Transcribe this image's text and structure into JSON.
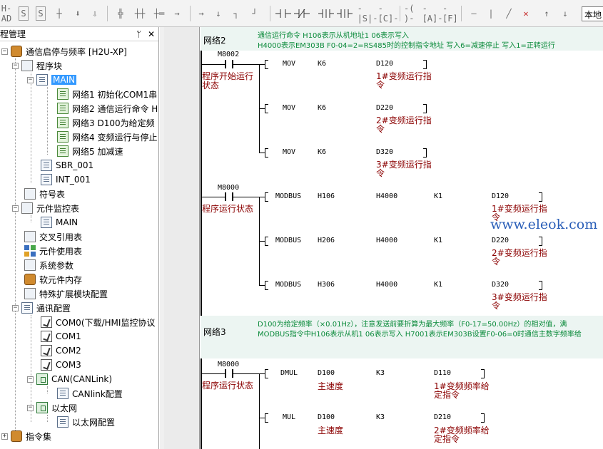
{
  "toolbar": {
    "right_box_text": "本地",
    "buttons": [
      "H-AD",
      "S",
      "S",
      "┼",
      "⬇",
      "⇩",
      "╬",
      "┼┼",
      "┼═",
      "→",
      "↓",
      "┐",
      "┘",
      "-|  |-",
      "-|/|-",
      "-|↑|-",
      "-|↓|-",
      "-|S|-",
      "-[C]-",
      "-( )-",
      "-[A]-",
      "-[F]",
      "—",
      "|",
      "╱",
      "✕",
      "↑",
      "↓"
    ]
  },
  "left_panel": {
    "title": "程管理",
    "pin": "ᛘ",
    "close": "✕",
    "tree": {
      "root": "通信启停与频率 [H2U-XP]",
      "program_block": "程序块",
      "main": "MAIN",
      "networks": [
        "网络1 初始化COM1串",
        "网络2 通信运行命令 H",
        "网络3 D100为给定频",
        "网络4 变频运行与停止",
        "网络5 加减速"
      ],
      "sbr": "SBR_001",
      "int": "INT_001",
      "symbol_table": "符号表",
      "monitor_table": "元件监控表",
      "monitor_main": "MAIN",
      "cross_ref": "交叉引用表",
      "usage_table": "元件使用表",
      "sys_params": "系统参数",
      "soft_memory": "软元件内存",
      "special_module": "特殊扩展模块配置",
      "comm_config": "通讯配置",
      "com0": "COM0(下载/HMI监控协议",
      "com1": "COM1",
      "com2": "COM2",
      "com3": "COM3",
      "can": "CAN(CANLink)",
      "canlink": "CANlink配置",
      "ethernet": "以太网",
      "ethernet_config": "以太网配置",
      "instruction_set": "指令集"
    }
  },
  "editor": {
    "network2": {
      "title": "网络2",
      "comment_line1": "通信运行命令 H106表示从机地址1 06表示写入",
      "comment_line2": "H4000表示EM303B F0-04=2=RS485时的控制指令地址 写入6=减速停止 写入1=正转运行",
      "contact1": "M8002",
      "contact1_comment": [
        "程序开始运行",
        "状态"
      ],
      "movs": [
        {
          "op": "MOV",
          "a": "K6",
          "b": "D120",
          "c": [
            "1#变频运行指",
            "令"
          ]
        },
        {
          "op": "MOV",
          "a": "K6",
          "b": "D220",
          "c": [
            "2#变频运行指",
            "令"
          ]
        },
        {
          "op": "MOV",
          "a": "K6",
          "b": "D320",
          "c": [
            "3#变频运行指",
            "令"
          ]
        }
      ],
      "contact2": "M8000",
      "contact2_comment": "程序运行状态",
      "modbus": [
        {
          "op": "MODBUS",
          "a": "H106",
          "b": "H4000",
          "k": "K1",
          "d": "D120",
          "c": [
            "1#变频运行指",
            "令"
          ]
        },
        {
          "op": "MODBUS",
          "a": "H206",
          "b": "H4000",
          "k": "K1",
          "d": "D220",
          "c": [
            "2#变频运行指",
            "令"
          ]
        },
        {
          "op": "MODBUS",
          "a": "H306",
          "b": "H4000",
          "k": "K1",
          "d": "D320",
          "c": [
            "3#变频运行指",
            "令"
          ]
        }
      ]
    },
    "network3": {
      "title": "网络3",
      "comment_line1": "D100为给定频率（×0.01Hz），注意发送前要折算为最大频率（F0-17=50.00Hz）的相对值，满",
      "comment_line2": "MODBUS指令中H106表示从机1 06表示写入 H7001表示EM303B设置F0-06=0时通信主数字频率给",
      "contact": "M8000",
      "contact_comment": "程序运行状态",
      "rows": [
        {
          "op": "DMUL",
          "a": "D100",
          "a_c": "主速度",
          "b": "K3",
          "d": "D110",
          "c": [
            "1#变频频率给",
            "定指令"
          ]
        },
        {
          "op": "MUL",
          "a": "D100",
          "a_c": "主速度",
          "b": "K3",
          "d": "D210",
          "c": [
            "2#变频频率给",
            "定指令"
          ]
        }
      ]
    },
    "watermark": "www.eleok.com"
  }
}
